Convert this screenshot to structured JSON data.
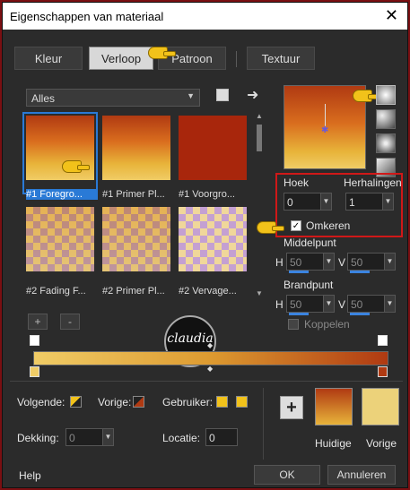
{
  "window": {
    "title": "Eigenschappen van materiaal",
    "close": "✕"
  },
  "tabs": [
    {
      "label": "Kleur",
      "active": false
    },
    {
      "label": "Verloop",
      "active": true
    },
    {
      "label": "Patroon",
      "active": false
    },
    {
      "label": "Textuur",
      "active": false
    }
  ],
  "filter": {
    "value": "Alles"
  },
  "thumbnails": [
    {
      "label": "#1 Foregro...",
      "selected": true
    },
    {
      "label": "#1 Primer Pl...",
      "selected": false
    },
    {
      "label": "#1 Voorgro...",
      "selected": false
    },
    {
      "label": "#2 Fading F...",
      "selected": false
    },
    {
      "label": "#2 Primer Pl...",
      "selected": false
    },
    {
      "label": "#2 Vervage...",
      "selected": false
    }
  ],
  "params": {
    "hoek_label": "Hoek",
    "hoek_value": "0",
    "herhalingen_label": "Herhalingen",
    "herhalingen_value": "1",
    "omkeren_label": "Omkeren",
    "omkeren_checked": true,
    "middelpunt_label": "Middelpunt",
    "brandpunt_label": "Brandpunt",
    "h_label": "H",
    "v_label": "V",
    "middel_h": "50",
    "middel_v": "50",
    "brand_h": "50",
    "brand_v": "50",
    "koppelen_label": "Koppelen",
    "koppelen_checked": false
  },
  "stops": {
    "add": "+",
    "remove": "-"
  },
  "bottom": {
    "volgende_label": "Volgende:",
    "vorige_label": "Vorige:",
    "gebruiker_label": "Gebruiker:",
    "dekking_label": "Dekking:",
    "dekking_value": "0",
    "locatie_label": "Locatie:",
    "locatie_value": "0",
    "add_button": "+",
    "huidige_label": "Huidige",
    "vorige2_label": "Vorige"
  },
  "footer": {
    "help": "Help",
    "ok": "OK",
    "cancel": "Annuleren"
  },
  "colors": {
    "gradient_start": "#f0cc66",
    "gradient_end": "#b03a12",
    "accent_blue": "#2a7ad6",
    "highlight_red": "#d01818"
  },
  "watermark": {
    "text": "claudia"
  },
  "icons": {
    "list": "list-view-icon",
    "arrow": "arrow-right-icon",
    "hand": "pointing-hand-icon"
  }
}
